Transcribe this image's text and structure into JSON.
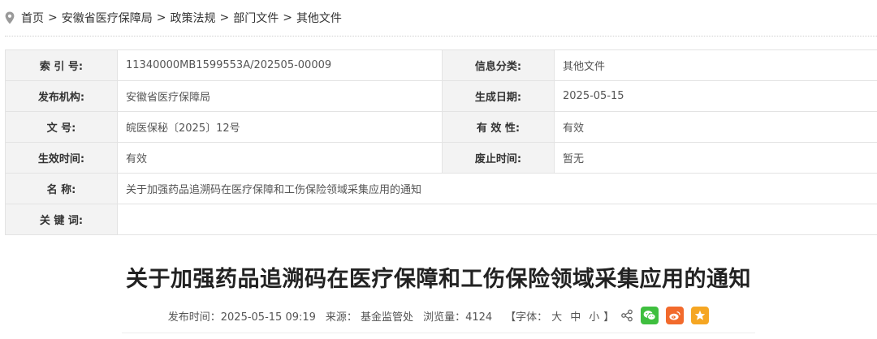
{
  "breadcrumb": {
    "items": [
      "首页",
      "安徽省医疗保障局",
      "政策法规",
      "部门文件",
      "其他文件"
    ],
    "separator": ">"
  },
  "info": {
    "index_label": "索 引 号:",
    "index_value": "11340000MB1599553A/202505-00009",
    "category_label": "信息分类:",
    "category_value": "其他文件",
    "publisher_label": "发布机构:",
    "publisher_value": "安徽省医疗保障局",
    "created_label": "生成日期:",
    "created_value": "2025-05-15",
    "docno_label": "文 号:",
    "docno_value": "皖医保秘〔2025〕12号",
    "validity_label": "有 效 性:",
    "validity_value": "有效",
    "effective_label": "生效时间:",
    "effective_value": "有效",
    "repeal_label": "废止时间:",
    "repeal_value": "暂无",
    "name_label": "名 称:",
    "name_value": "关于加强药品追溯码在医疗保障和工伤保险领域采集应用的通知",
    "keywords_label": "关 键 词:",
    "keywords_value": ""
  },
  "article": {
    "title": "关于加强药品追溯码在医疗保障和工伤保险领域采集应用的通知",
    "publish_time": "发布时间：2025-05-15 09:19",
    "source": "来源：  基金监管处",
    "views": "浏览量：4124",
    "font_prefix": "【字体：",
    "font_large": "大",
    "font_medium": "中",
    "font_small": "小",
    "font_suffix": "】"
  },
  "icons": {
    "breadcrumb": "location-pin-icon",
    "share": "share-icon",
    "wechat": "wechat-icon",
    "weibo": "weibo-icon",
    "favorite": "star-icon"
  },
  "colors": {
    "wechat": "#3fbf3f",
    "weibo": "#f26a2c",
    "favorite": "#f5a623",
    "label_bg": "#f3f3f3"
  }
}
